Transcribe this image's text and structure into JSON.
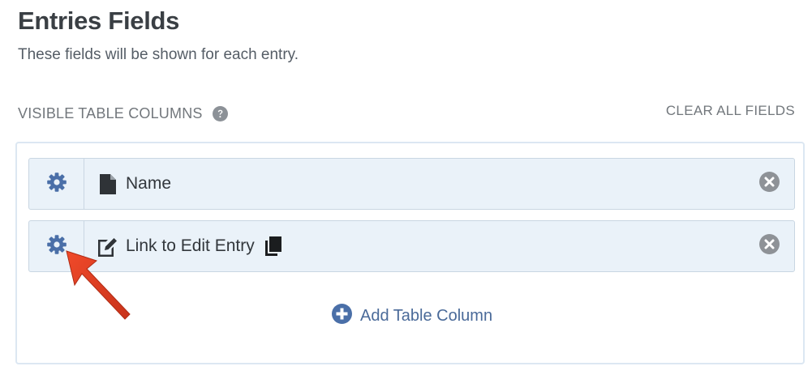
{
  "section": {
    "title": "Entries Fields",
    "description": "These fields will be shown for each entry."
  },
  "columns": {
    "heading": "VISIBLE TABLE COLUMNS",
    "clear_all_label": "CLEAR ALL FIELDS",
    "fields": [
      {
        "label": "Name",
        "icon": "document-icon"
      },
      {
        "label": "Link to Edit Entry",
        "icon": "edit-icon",
        "extra_icon": "copy-icon"
      }
    ],
    "add_label": "Add Table Column"
  },
  "icons": {
    "gear": "gear-icon",
    "remove": "remove-icon",
    "help": "help-icon",
    "add": "plus-circle-icon"
  },
  "colors": {
    "accent": "#4a6a99",
    "row_background": "#eaf2f9",
    "box_border": "#dce7f2",
    "annotation_arrow": "#e0391f"
  }
}
